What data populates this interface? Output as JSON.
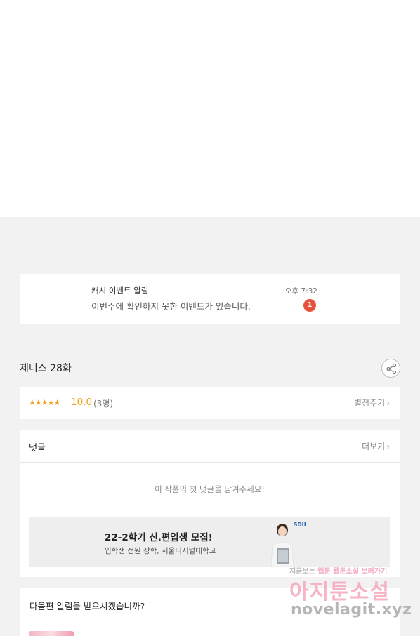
{
  "notification": {
    "title": "캐시 이벤트 알림",
    "message": "이번주에 확인하지 못한 이벤트가 있습니다.",
    "time": "오후 7:32",
    "badge": "1"
  },
  "episode": {
    "title": "제니스 28화"
  },
  "rating": {
    "stars": "★★★★★",
    "score": "10.0",
    "count": "(3명)",
    "rate_link": "별점주기"
  },
  "comments": {
    "title": "댓글",
    "more": "더보기",
    "empty_text": "이 작품의 첫 댓글을 남겨주세요!"
  },
  "ad": {
    "title": "22-2학기 신.편입생 모집!",
    "subtitle": "입학생 전원 장학, 서울디지털대학교",
    "logo": "SDU"
  },
  "next_alert": {
    "title": "다음편 알림을 받으시겠습니까?"
  },
  "watermark": {
    "line1_a": "지금보는",
    "line1_b": "웹툰",
    "line1_c": "웹툰소설 보러가기",
    "brand": "아지툰소설",
    "url": "novelagit.xyz"
  },
  "colors": {
    "accent_star": "#f2a01b",
    "badge": "#e8513b"
  }
}
